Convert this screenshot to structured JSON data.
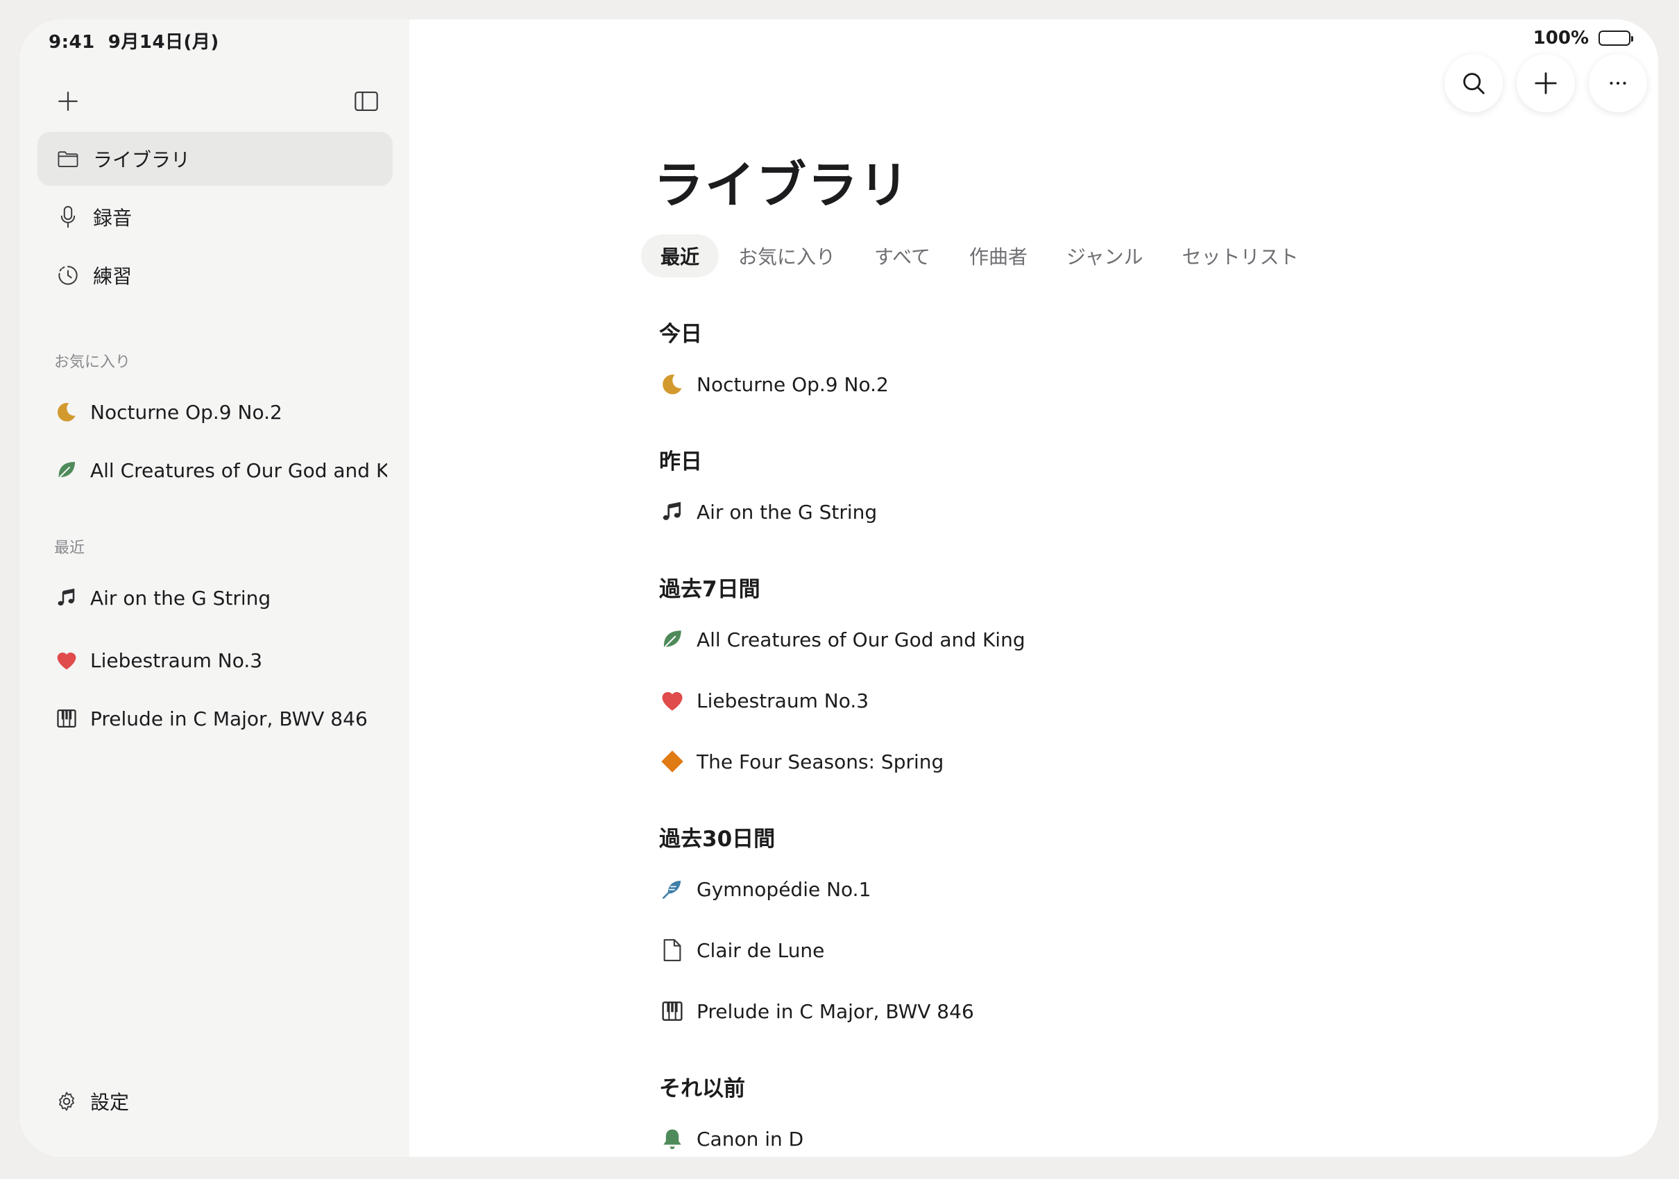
{
  "status_bar": {
    "time": "9:41",
    "date": "9月14日(月)",
    "battery": "100%"
  },
  "sidebar": {
    "nav": [
      {
        "label": "ライブラリ",
        "icon": "folder-icon"
      },
      {
        "label": "録音",
        "icon": "microphone-icon"
      },
      {
        "label": "練習",
        "icon": "practice-timer-icon"
      }
    ],
    "favorites_label": "お気に入り",
    "favorites": [
      {
        "title": "Nocturne Op.9 No.2",
        "icon": "moon-icon"
      },
      {
        "title": "All Creatures of Our God and K...",
        "icon": "leaf-icon"
      }
    ],
    "recent_label": "最近",
    "recent": [
      {
        "title": "Air on the G String",
        "icon": "music-note-icon"
      },
      {
        "title": "Liebestraum No.3",
        "icon": "heart-icon"
      },
      {
        "title": "Prelude in C Major, BWV 846",
        "icon": "piano-icon"
      }
    ],
    "settings_label": "設定"
  },
  "main": {
    "title": "ライブラリ",
    "tabs": [
      "最近",
      "お気に入り",
      "すべて",
      "作曲者",
      "ジャンル",
      "セットリスト"
    ],
    "active_tab": "最近",
    "groups": [
      {
        "heading": "今日",
        "items": [
          {
            "title": "Nocturne Op.9 No.2",
            "icon": "moon-icon"
          }
        ]
      },
      {
        "heading": "昨日",
        "items": [
          {
            "title": "Air on the G String",
            "icon": "music-note-icon"
          }
        ]
      },
      {
        "heading": "過去7日間",
        "items": [
          {
            "title": "All Creatures of Our God and King",
            "icon": "leaf-icon"
          },
          {
            "title": "Liebestraum No.3",
            "icon": "heart-icon"
          },
          {
            "title": "The Four Seasons: Spring",
            "icon": "diamond-icon"
          }
        ]
      },
      {
        "heading": "過去30日間",
        "items": [
          {
            "title": "Gymnopédie No.1",
            "icon": "feather-icon"
          },
          {
            "title": "Clair de Lune",
            "icon": "document-icon"
          },
          {
            "title": "Prelude in C Major, BWV 846",
            "icon": "piano-icon"
          }
        ]
      },
      {
        "heading": "それ以前",
        "items": [
          {
            "title": "Canon in D",
            "icon": "bell-icon"
          }
        ]
      }
    ]
  },
  "colors": {
    "moon": "#d29a2e",
    "leaf": "#4f8a5b",
    "heart": "#e04b4b",
    "diamond": "#e07a12",
    "feather": "#3d7fa8",
    "bell": "#4f8a5b"
  }
}
